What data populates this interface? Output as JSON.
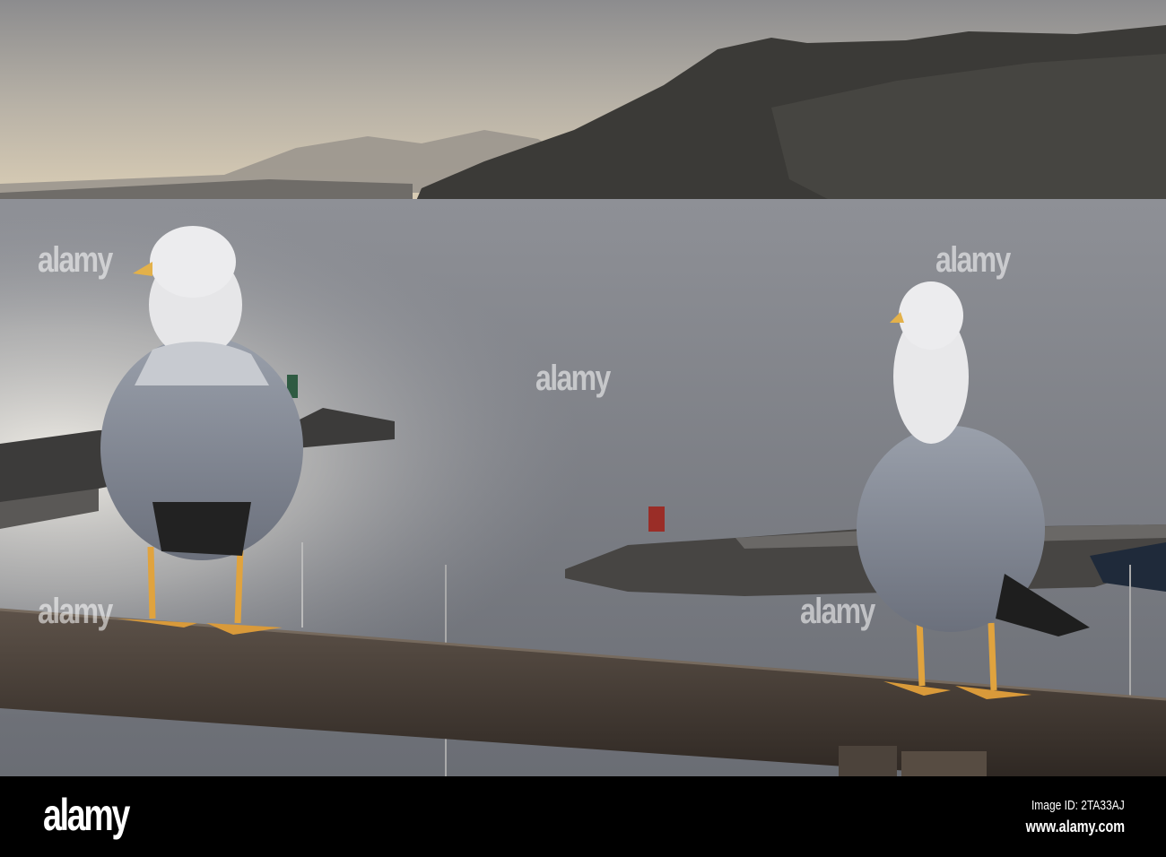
{
  "photo": {
    "subject": "Two seagulls on a wooden rail above a harbour",
    "colors": {
      "sky_top": "#8c8c8e",
      "sky_horizon": "#d9cdb4",
      "sea": "#7c7f86",
      "headland": "#3b3a37",
      "rail": "#4a3f36"
    }
  },
  "watermark": {
    "text": "alamy"
  },
  "footer": {
    "logo": "alamy",
    "image_id": "Image ID: 2TA33AJ",
    "website": "www.alamy.com"
  }
}
